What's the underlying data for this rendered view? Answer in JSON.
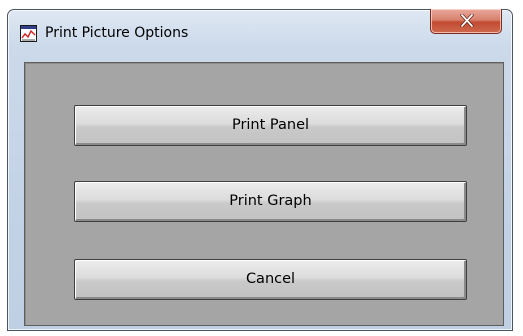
{
  "window": {
    "title": "Print Picture Options",
    "title_icon": "graph-document-icon",
    "close_icon": "close-x-icon"
  },
  "buttons": {
    "print_panel": "Print Panel",
    "print_graph": "Print Graph",
    "cancel": "Cancel"
  },
  "colors": {
    "client_background": "#a5a5a5",
    "close_button": "#c24a32",
    "frame": "#c3d3e6"
  }
}
